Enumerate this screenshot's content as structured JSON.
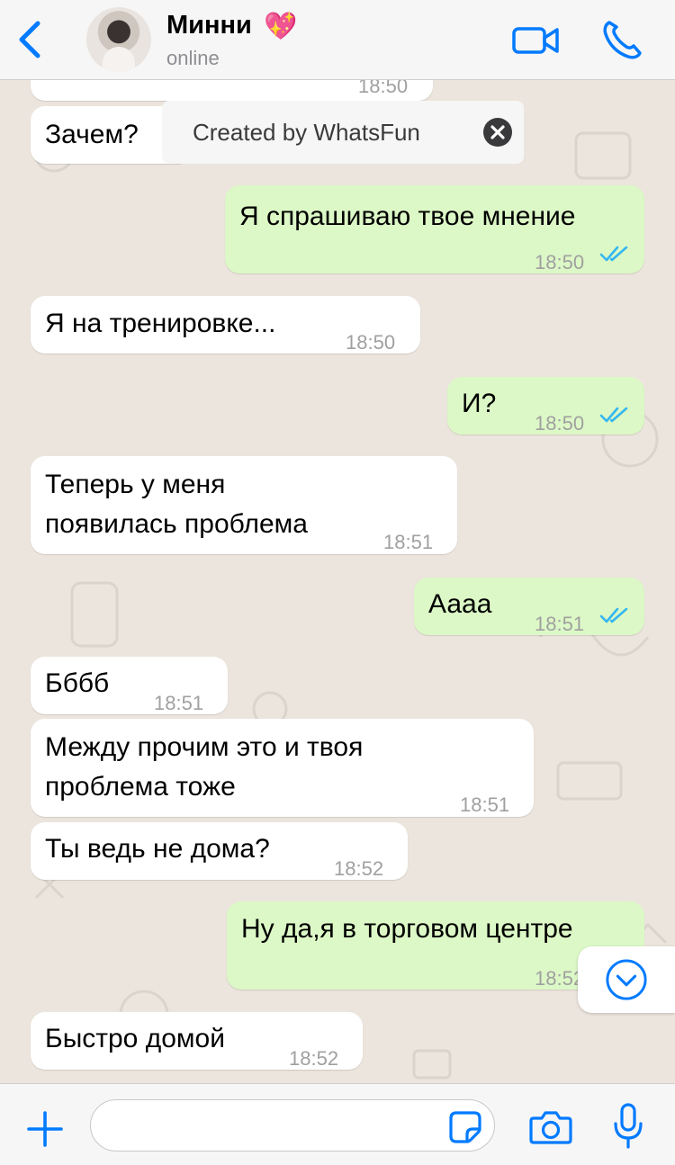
{
  "header": {
    "contact_name": "Минни",
    "heart_emoji": "💖",
    "status": "online"
  },
  "banner": {
    "text": "Created by WhatsFun"
  },
  "messages": [
    {
      "direction": "in",
      "text": "",
      "time": "18:50"
    },
    {
      "direction": "in",
      "text": "Зачем?",
      "time": ""
    },
    {
      "direction": "out",
      "text": "Я спрашиваю твое мнение",
      "time": "18:50",
      "read": true
    },
    {
      "direction": "in",
      "text": "Я на тренировке...",
      "time": "18:50"
    },
    {
      "direction": "out",
      "text": "И?",
      "time": "18:50",
      "read": true
    },
    {
      "direction": "in",
      "text": "Теперь у меня\nпоявилась проблема",
      "time": "18:51"
    },
    {
      "direction": "out",
      "text": "Аааа",
      "time": "18:51",
      "read": true
    },
    {
      "direction": "in",
      "text": "Бббб",
      "time": "18:51"
    },
    {
      "direction": "in",
      "text": "Между прочим это и твоя\nпроблема тоже",
      "time": "18:51"
    },
    {
      "direction": "in",
      "text": "Ты ведь не дома?",
      "time": "18:52"
    },
    {
      "direction": "out",
      "text": "Ну да,я в торговом центре",
      "time": "18:52"
    },
    {
      "direction": "in",
      "text": "Быстро домой",
      "time": "18:52"
    }
  ],
  "composer": {
    "value": "",
    "placeholder": ""
  },
  "colors": {
    "accent": "#007AFF",
    "incoming_bubble": "#FFFFFF",
    "outgoing_bubble": "#DCF8C6",
    "read_ticks": "#34B7F1",
    "chat_background": "#ECE5DD"
  },
  "icons": {
    "back": "chevron-left-icon",
    "video": "video-camera-icon",
    "call": "phone-icon",
    "banner_close": "close-icon",
    "scroll": "chevron-down-circle-icon",
    "attach": "plus-icon",
    "sticker": "sticker-icon",
    "camera": "camera-icon",
    "mic": "microphone-icon"
  }
}
